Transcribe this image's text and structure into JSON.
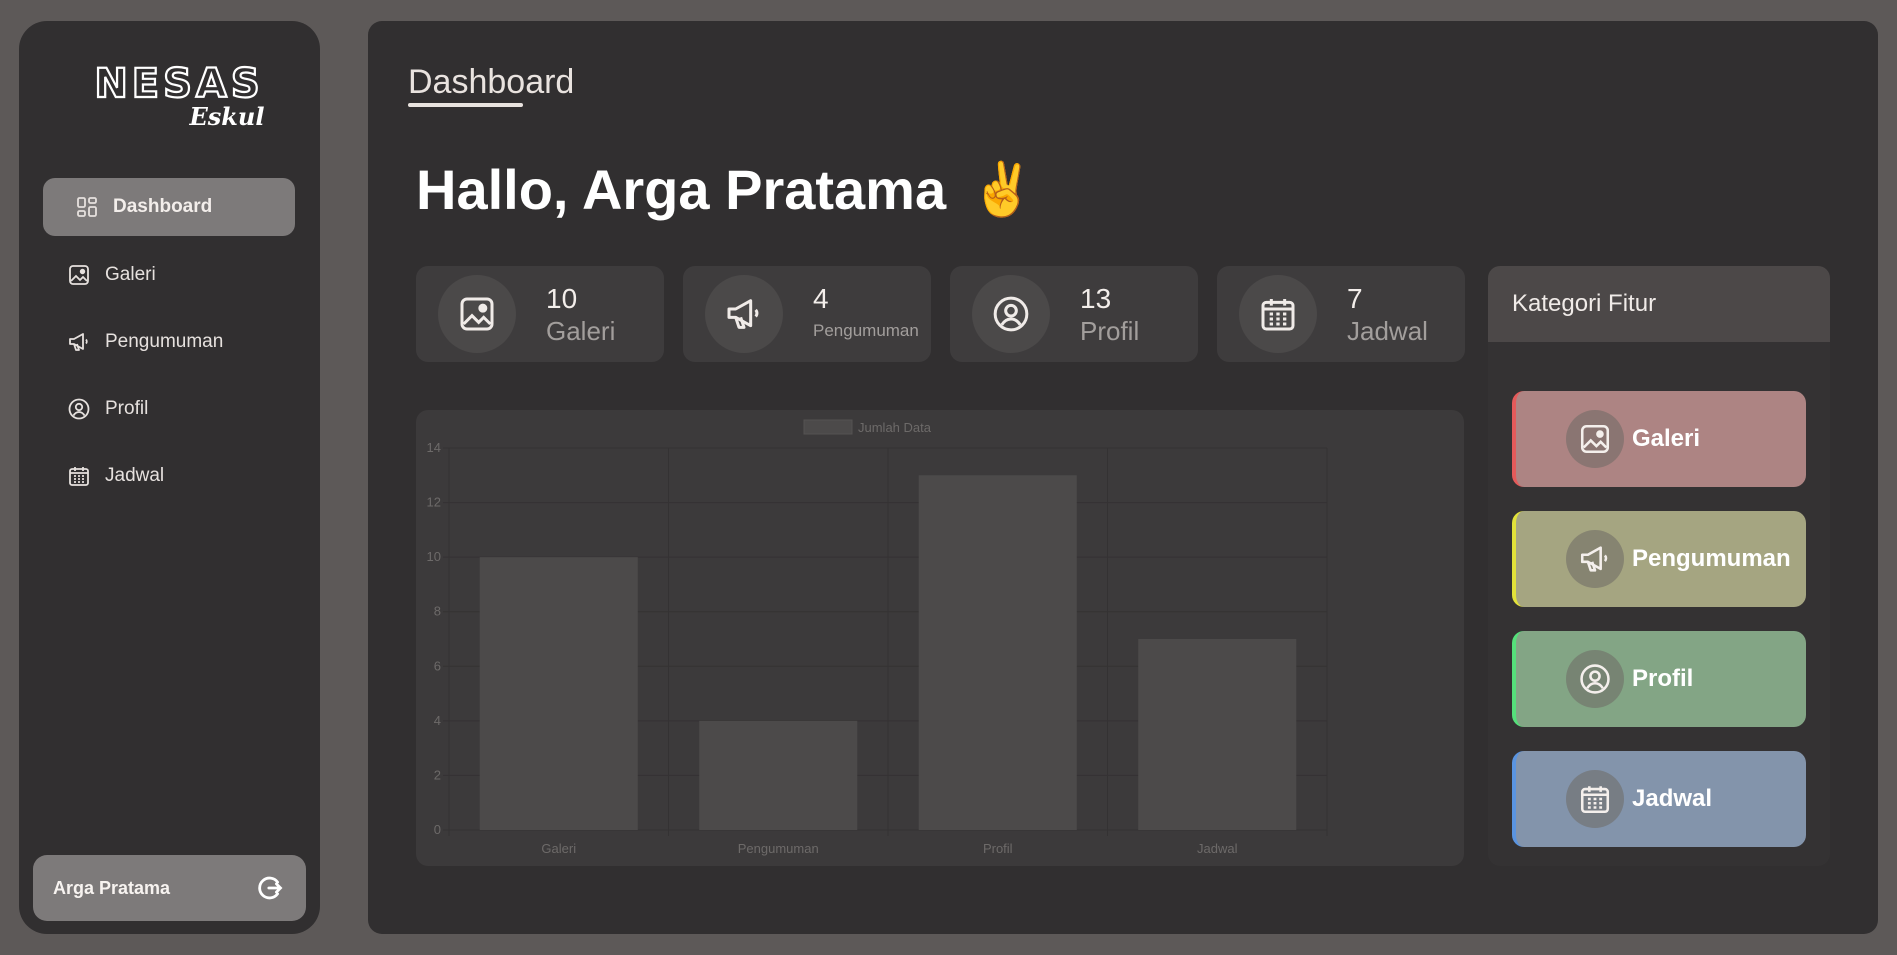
{
  "brand": {
    "logo_main": "NESAS",
    "logo_sub": "Eskul"
  },
  "sidebar": {
    "items": [
      {
        "label": "Dashboard",
        "icon": "dashboard-icon",
        "active": true
      },
      {
        "label": "Galeri",
        "icon": "image-icon"
      },
      {
        "label": "Pengumuman",
        "icon": "megaphone-icon"
      },
      {
        "label": "Profil",
        "icon": "user-circle-icon"
      },
      {
        "label": "Jadwal",
        "icon": "calendar-icon"
      }
    ],
    "user_name": "Arga Pratama",
    "logout_icon": "logout-icon"
  },
  "main": {
    "page_title": "Dashboard",
    "greeting": "Hallo, Arga Pratama",
    "greeting_emoji": "✌️",
    "stats": [
      {
        "value": "10",
        "label": "Galeri",
        "icon": "image-icon"
      },
      {
        "value": "4",
        "label": "Pengumuman",
        "icon": "megaphone-icon"
      },
      {
        "value": "13",
        "label": "Profil",
        "icon": "user-circle-icon"
      },
      {
        "value": "7",
        "label": "Jadwal",
        "icon": "calendar-icon"
      }
    ]
  },
  "kategori": {
    "title": "Kategori Fitur",
    "items": [
      {
        "label": "Galeri",
        "icon": "image-icon",
        "color": "#ad8483",
        "accent": "#e45a5a"
      },
      {
        "label": "Pengumuman",
        "icon": "megaphone-icon",
        "color": "#a5a581",
        "accent": "#e2e23a"
      },
      {
        "label": "Profil",
        "icon": "user-circle-icon",
        "color": "#83a585",
        "accent": "#55e07a"
      },
      {
        "label": "Jadwal",
        "icon": "calendar-icon",
        "color": "#8394ab",
        "accent": "#5a94e0"
      }
    ]
  },
  "chart_data": {
    "type": "bar",
    "categories": [
      "Galeri",
      "Pengumuman",
      "Profil",
      "Jadwal"
    ],
    "series": [
      {
        "name": "Jumlah Data",
        "values": [
          10,
          4,
          13,
          7
        ]
      }
    ],
    "ylim": [
      0,
      14
    ],
    "yticks": [
      0,
      2,
      4,
      6,
      8,
      10,
      12,
      14
    ],
    "grid": true,
    "legend": "top-center"
  }
}
